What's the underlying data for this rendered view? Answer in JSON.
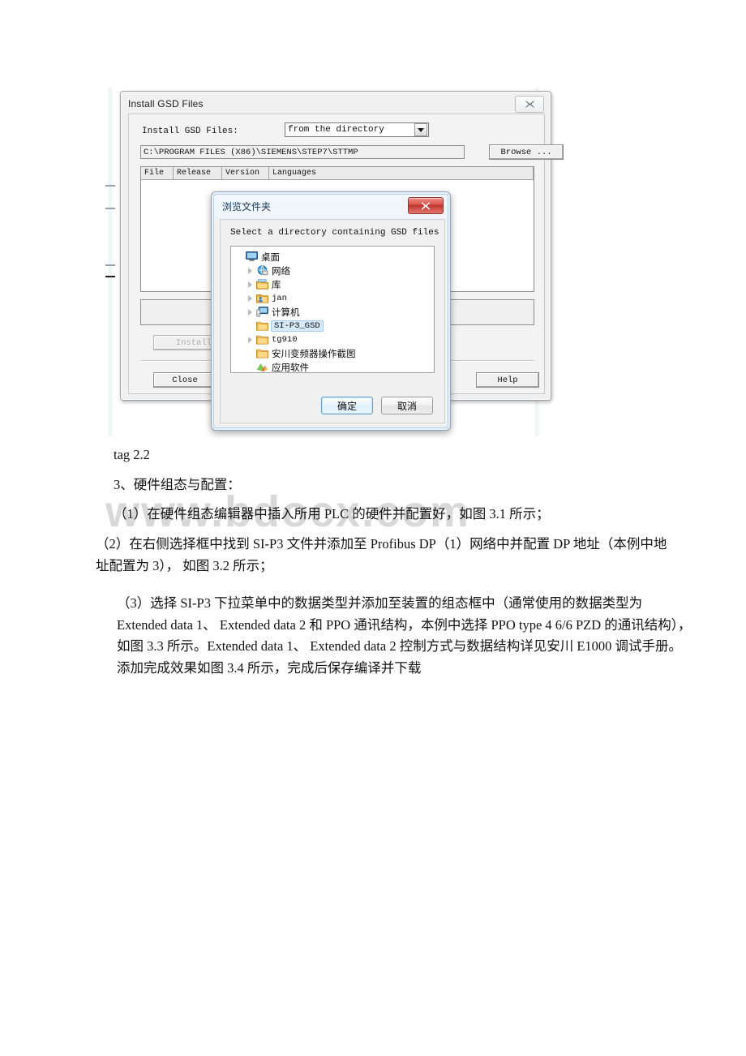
{
  "watermark": {
    "text": "www.bdocx.com"
  },
  "install_gsd_dialog": {
    "title": "Install GSD Files",
    "close_glyph": "✖",
    "field_label": "Install GSD Files:",
    "source_combo": {
      "value": "from the directory",
      "options": [
        "from the directory"
      ]
    },
    "path_value": "C:\\PROGRAM FILES (X86)\\SIEMENS\\STEP7\\STTMP",
    "browse_label": "Browse ...",
    "table": {
      "columns": [
        "File",
        "Release",
        "Version",
        "Languages"
      ],
      "rows": []
    },
    "install_label": "Install",
    "close_label": "Close",
    "help_label": "Help"
  },
  "browse_folder_dialog": {
    "title": "浏览文件夹",
    "close_glyph": "x",
    "prompt": "Select a directory containing GSD files",
    "tree": [
      {
        "label": "桌面",
        "icon": "desktop-icon",
        "indent": 0,
        "expander": false,
        "selected": false,
        "cjk": true
      },
      {
        "label": "网络",
        "icon": "network-icon",
        "indent": 1,
        "expander": true,
        "selected": false,
        "cjk": true
      },
      {
        "label": "库",
        "icon": "library-icon",
        "indent": 1,
        "expander": true,
        "selected": false,
        "cjk": true
      },
      {
        "label": "jan",
        "icon": "user-icon",
        "indent": 1,
        "expander": true,
        "selected": false,
        "cjk": false
      },
      {
        "label": "计算机",
        "icon": "computer-icon",
        "indent": 1,
        "expander": true,
        "selected": false,
        "cjk": true
      },
      {
        "label": "SI-P3_GSD",
        "icon": "folder-icon",
        "indent": 1,
        "expander": false,
        "selected": true,
        "cjk": false
      },
      {
        "label": "tg910",
        "icon": "folder-icon",
        "indent": 1,
        "expander": true,
        "selected": false,
        "cjk": false
      },
      {
        "label": "安川变频器操作截图",
        "icon": "folder-icon",
        "indent": 1,
        "expander": false,
        "selected": false,
        "cjk": true
      },
      {
        "label": "应用软件",
        "icon": "app-icon",
        "indent": 1,
        "expander": false,
        "selected": false,
        "cjk": true
      }
    ],
    "ok_label": "确定",
    "cancel_label": "取消"
  },
  "document": {
    "caption": "tag 2.2",
    "heading": "3、硬件组态与配置：",
    "para1": "（1）在硬件组态编辑器中插入所用 PLC 的硬件并配置好，如图 3.1 所示；",
    "para2": "（2）在右侧选择框中找到 SI-P3 文件并添加至 Profibus DP（1）网络中并配置 DP 地址（本例中地址配置为 3）， 如图 3.2 所示；",
    "para3": "（3）选择 SI-P3 下拉菜单中的数据类型并添加至装置的组态框中（通常使用的数据类型为 Extended data 1、 Extended data 2 和 PPO 通讯结构，本例中选择 PPO type 4 6/6 PZD 的通讯结构），如图 3.3 所示。Extended data 1、 Extended data 2 控制方式与数据结构详见安川 E1000 调试手册。添加完成效果如图 3.4 所示，完成后保存编译并下载"
  },
  "colors": {
    "dialog_face": "#f0f0f0",
    "selection_blue": "#d6e9f8",
    "close_red": "#c0342c",
    "watermark_grey": "#d8d8d8"
  }
}
